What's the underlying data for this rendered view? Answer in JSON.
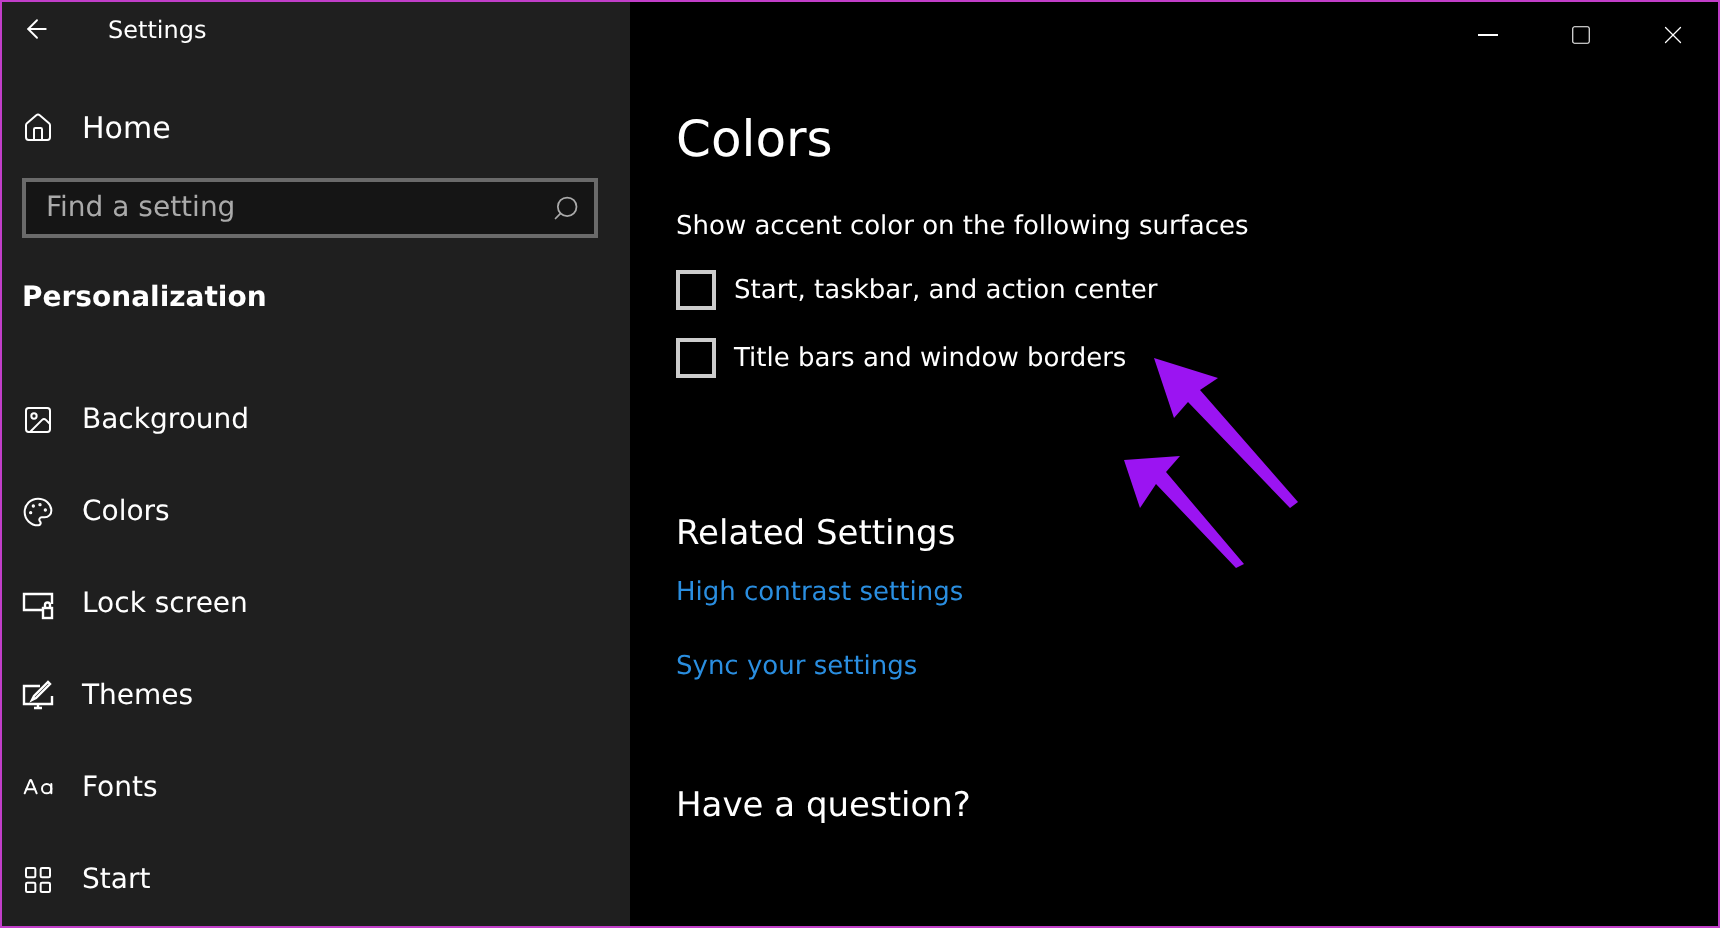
{
  "window": {
    "title": "Settings"
  },
  "sidebar": {
    "home": "Home",
    "search": {
      "placeholder": "Find a setting"
    },
    "section": "Personalization",
    "items": [
      {
        "label": "Background",
        "kind": "image"
      },
      {
        "label": "Colors",
        "kind": "palette"
      },
      {
        "label": "Lock screen",
        "kind": "lock"
      },
      {
        "label": "Themes",
        "kind": "themes"
      },
      {
        "label": "Fonts",
        "kind": "fonts"
      },
      {
        "label": "Start",
        "kind": "start"
      }
    ]
  },
  "content": {
    "title": "Colors",
    "accent_heading": "Show accent color on the following surfaces",
    "checkboxes": [
      {
        "label": "Start, taskbar, and action center",
        "checked": false
      },
      {
        "label": "Title bars and window borders",
        "checked": false
      }
    ],
    "related_heading": "Related Settings",
    "links": [
      "High contrast settings",
      "Sync your settings"
    ],
    "question_heading": "Have a question?"
  }
}
